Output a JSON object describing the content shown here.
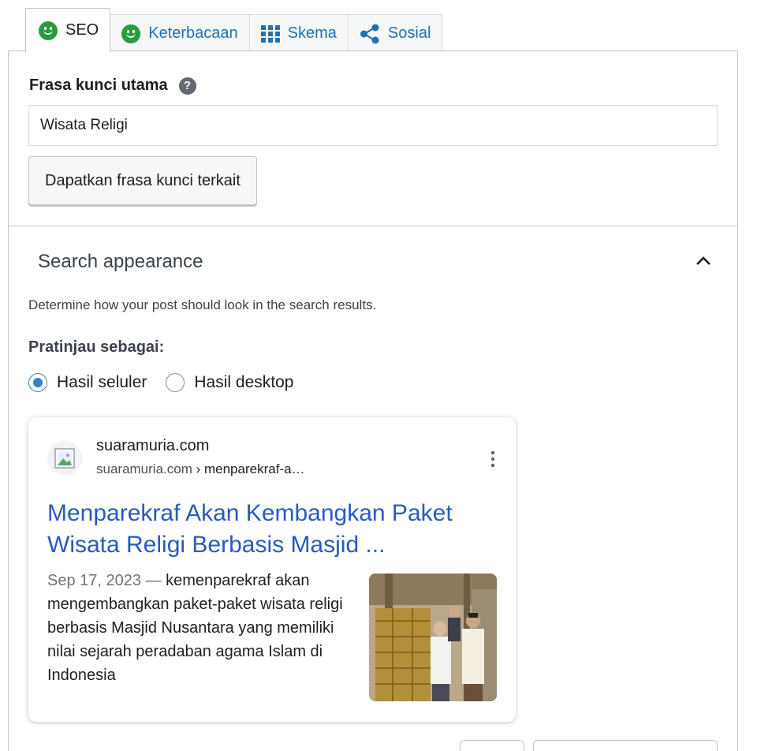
{
  "tabs": [
    {
      "label": "SEO",
      "icon": "smiley-green-icon",
      "active": true
    },
    {
      "label": "Keterbacaan",
      "icon": "smiley-green-icon",
      "active": false
    },
    {
      "label": "Skema",
      "icon": "grid-icon",
      "active": false
    },
    {
      "label": "Sosial",
      "icon": "share-icon",
      "active": false
    }
  ],
  "keyphrase": {
    "label": "Frasa kunci utama",
    "help": "?",
    "value": "Wisata Religi",
    "related_button": "Dapatkan frasa kunci terkait"
  },
  "search_appearance": {
    "title": "Search appearance",
    "description": "Determine how your post should look in the search results.",
    "preview_label": "Pratinjau sebagai:",
    "options": [
      {
        "label": "Hasil seluler",
        "checked": true
      },
      {
        "label": "Hasil desktop",
        "checked": false
      }
    ]
  },
  "google_preview": {
    "site_name": "suaramuria.com",
    "url_domain": "suaramuria.com",
    "url_path": " › menparekraf-a…",
    "title": "Menparekraf Akan Kembangkan Paket Wisata Religi Berbasis Masjid ...",
    "date": "Sep 17, 2023",
    "separator": " — ",
    "snippet": "kemenparekraf akan mengembangkan paket-paket wisata religi berbasis Masjid Nusantara yang memiliki nilai sejarah peradaban agama Islam di Indonesia"
  },
  "colors": {
    "accent": "#2271b1",
    "seo_good": "#2a9b3e",
    "radio_checked": "#3582c4",
    "google_title": "#2a59c0"
  }
}
